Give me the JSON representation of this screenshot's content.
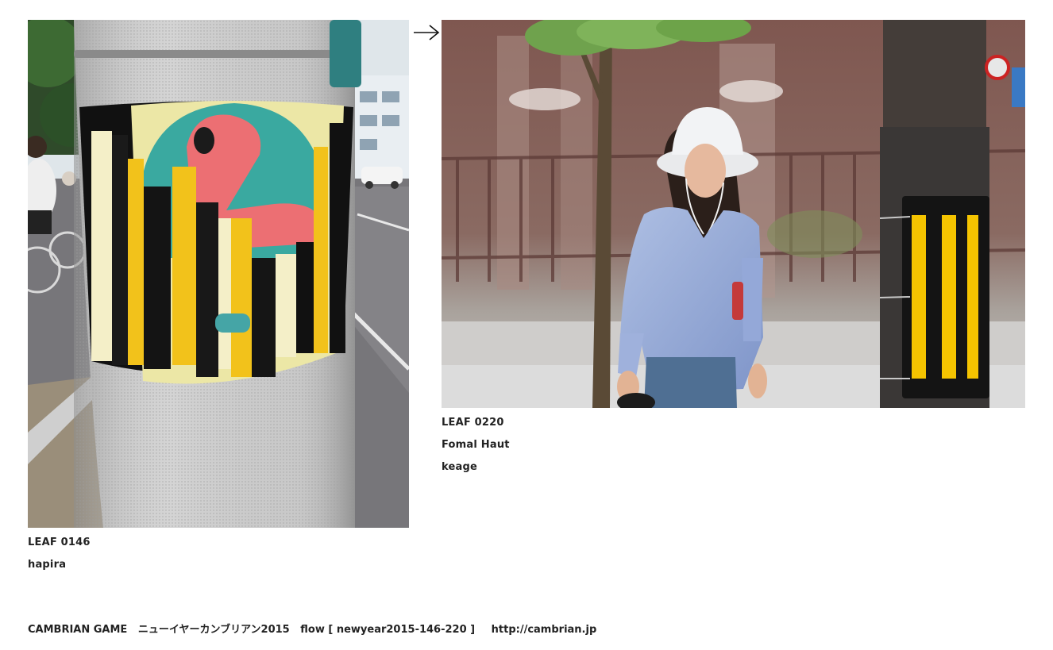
{
  "leaf_left": {
    "number": "LEAF 0146",
    "title": "hapira"
  },
  "leaf_right": {
    "number": "LEAF 0220",
    "title": "Fomal Haut",
    "location": "keage"
  },
  "navigation": {
    "arrow_icon": "right-arrow-icon"
  },
  "footer": {
    "brand": "CAMBRIAN GAME",
    "event": "ニューイヤーカンブリアン2015",
    "flow": "flow [ newyear2015-146-220 ]",
    "url": "http://cambrian.jp"
  },
  "colors": {
    "text": "#222222",
    "background": "#ffffff",
    "sticker_yellow": "#f2c21b",
    "sticker_teal": "#3aa9a0",
    "sticker_pink": "#ec6f73"
  }
}
